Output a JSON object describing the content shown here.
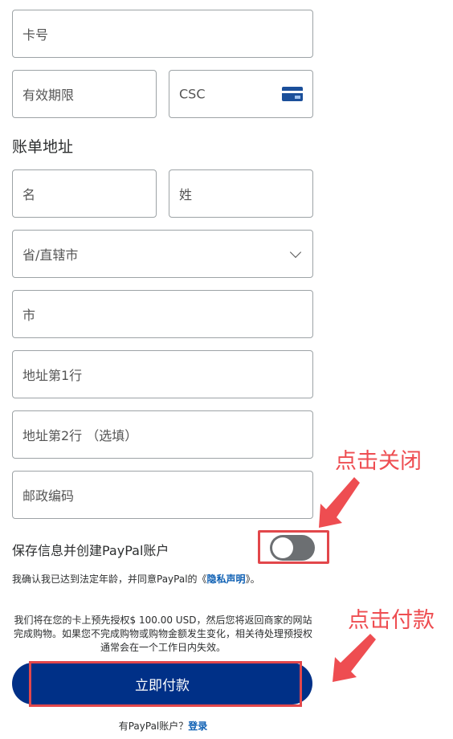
{
  "form": {
    "card_number_placeholder": "卡号",
    "expiry_placeholder": "有效期限",
    "csc_placeholder": "CSC",
    "billing_title": "账单地址",
    "first_name_placeholder": "名",
    "last_name_placeholder": "姓",
    "province_placeholder": "省/直辖市",
    "city_placeholder": "市",
    "address1_placeholder": "地址第1行",
    "address2_placeholder": "地址第2行 （选填）",
    "postal_placeholder": "邮政编码"
  },
  "save_info": {
    "label": "保存信息并创建PayPal账户",
    "toggle_state": "off"
  },
  "consent": {
    "prefix": "我确认我已达到法定年龄，并同意PayPal的《",
    "link": "隐私声明",
    "suffix": "》。"
  },
  "authorization_text": "我们将在您的卡上预先授权$ 100.00 USD，然后您将返回商家的网站完成购物。如果您不完成购物或购物金额发生变化，相关待处理预授权通常会在一个工作日内失效。",
  "pay_button": "立即付款",
  "login": {
    "prefix": "有PayPal账户？",
    "link": "登录"
  },
  "annotations": {
    "toggle_note": "点击关闭",
    "pay_note": "点击付款",
    "color": "#ee4d51"
  }
}
